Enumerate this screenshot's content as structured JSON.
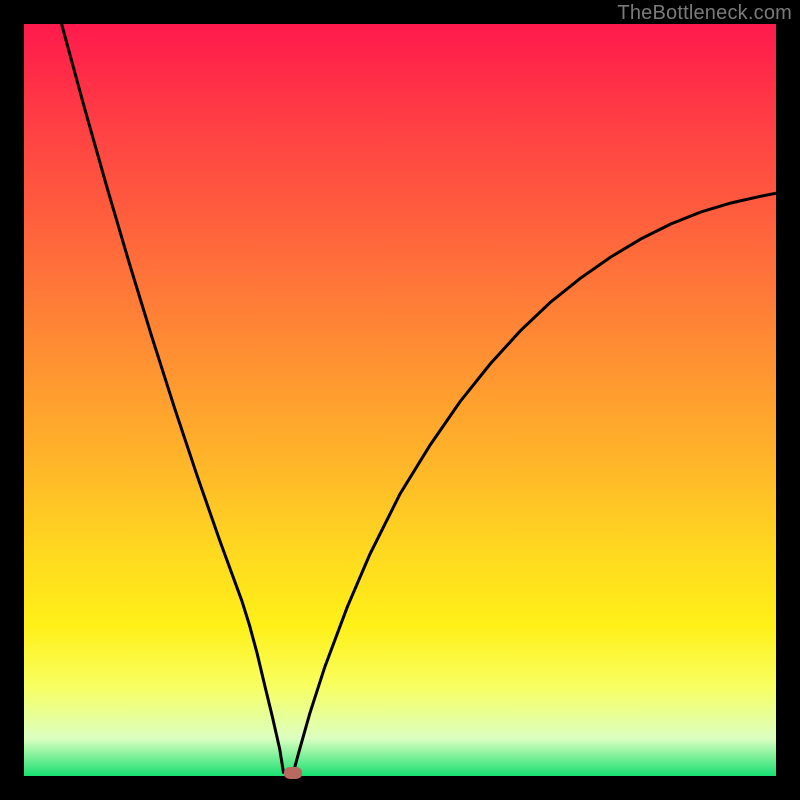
{
  "watermark": "TheBottleneck.com",
  "colors": {
    "frame": "#000000",
    "curve_stroke": "#000000",
    "trough_fill": "#b96a60"
  },
  "chart_data": {
    "type": "line",
    "title": "",
    "xlabel": "",
    "ylabel": "",
    "xlim": [
      0,
      100
    ],
    "ylim": [
      0,
      100
    ],
    "grid": false,
    "legend": false,
    "series": [
      {
        "name": "left-branch",
        "x": [
          5,
          8,
          11,
          14,
          17,
          20,
          23,
          26,
          29,
          30,
          31,
          32,
          33,
          34,
          34.5
        ],
        "values": [
          100,
          89,
          78.4,
          68.2,
          58.4,
          49.0,
          40.0,
          31.4,
          23.2,
          20.0,
          16.3,
          12.1,
          8.0,
          3.6,
          0.5
        ]
      },
      {
        "name": "trough-flat",
        "x": [
          34.5,
          35.0,
          35.8
        ],
        "values": [
          0.5,
          0.4,
          0.4
        ]
      },
      {
        "name": "right-branch",
        "x": [
          35.8,
          36.5,
          38,
          40,
          43,
          46,
          50,
          54,
          58,
          62,
          66,
          70,
          74,
          78,
          82,
          86,
          90,
          94,
          98,
          100
        ],
        "values": [
          0.4,
          3.0,
          8.3,
          14.5,
          22.5,
          29.5,
          37.5,
          44.0,
          49.8,
          54.8,
          59.2,
          63.0,
          66.2,
          69.0,
          71.4,
          73.4,
          75.0,
          76.2,
          77.1,
          77.5
        ]
      }
    ],
    "annotations": [
      {
        "name": "trough-marker",
        "x": 35.8,
        "y": 0.4
      }
    ]
  }
}
